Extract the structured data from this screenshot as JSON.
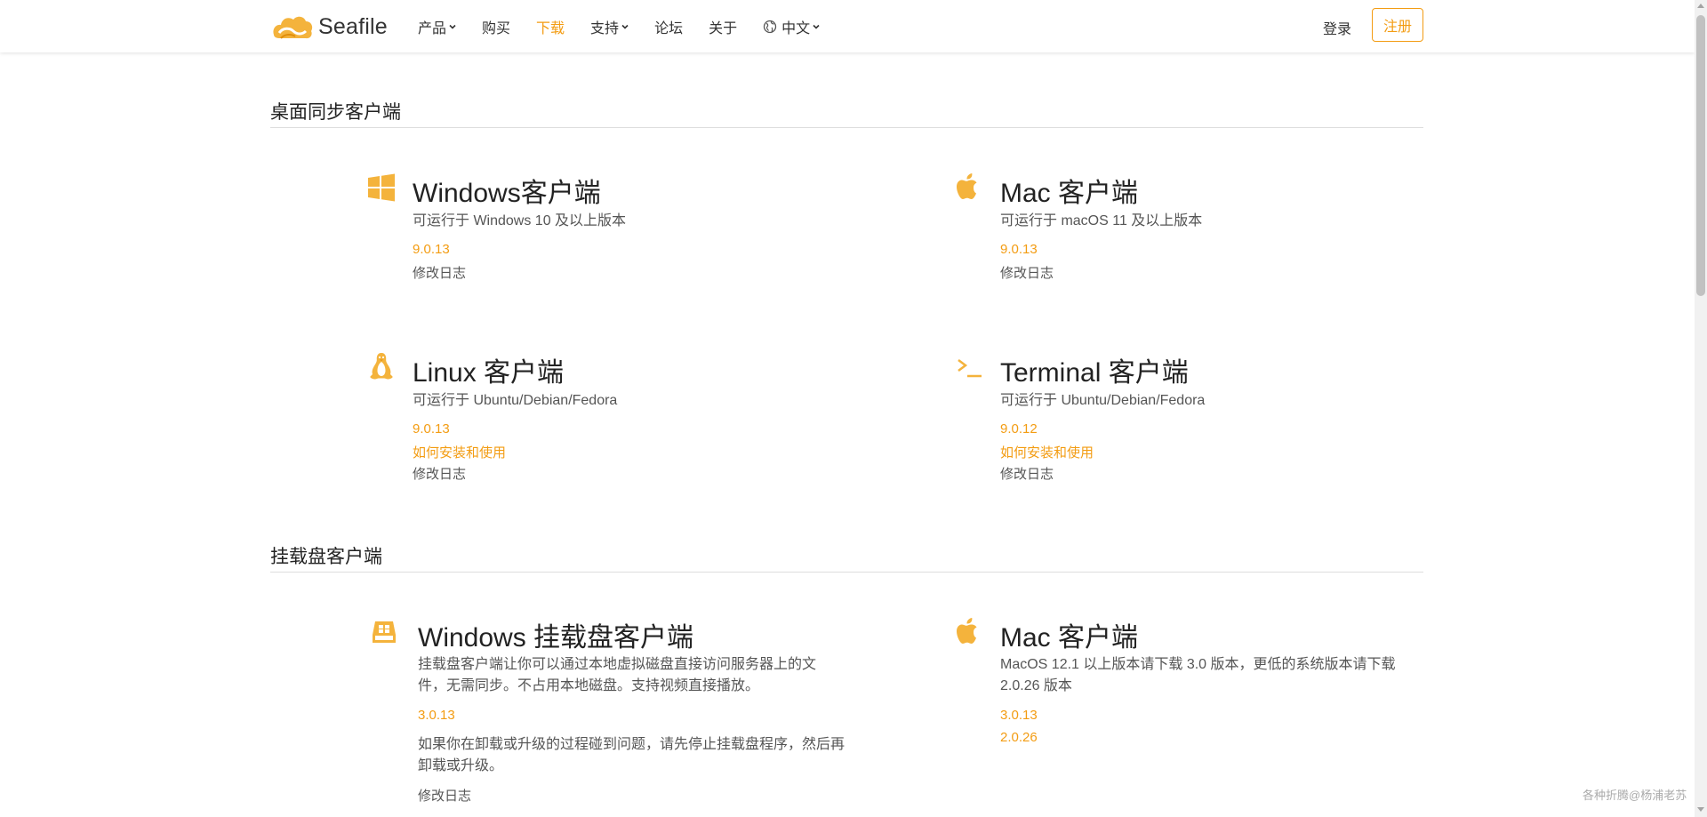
{
  "brand": {
    "name": "Seafile"
  },
  "nav": {
    "items": [
      {
        "label": "产品",
        "has_dropdown": true
      },
      {
        "label": "购买",
        "has_dropdown": false
      },
      {
        "label": "下载",
        "has_dropdown": false,
        "active": true
      },
      {
        "label": "支持",
        "has_dropdown": true
      },
      {
        "label": "论坛",
        "has_dropdown": false
      },
      {
        "label": "关于",
        "has_dropdown": false
      }
    ],
    "language": "中文",
    "login": "登录",
    "register": "注册"
  },
  "colors": {
    "accent": "#f39c12",
    "text": "#333333",
    "divider": "#dddddd"
  },
  "sections": [
    {
      "title": "桌面同步客户端",
      "clients": [
        {
          "icon": "windows-icon",
          "title": "Windows客户端",
          "desc": "可运行于 Windows 10 及以上版本",
          "links": [
            "9.0.13"
          ],
          "changelog": "修改日志"
        },
        {
          "icon": "apple-icon",
          "title": "Mac 客户端",
          "desc": "可运行于 macOS 11 及以上版本",
          "links": [
            "9.0.13"
          ],
          "changelog": "修改日志"
        },
        {
          "icon": "linux-icon",
          "title": "Linux 客户端",
          "desc": "可运行于 Ubuntu/Debian/Fedora",
          "links": [
            "9.0.13",
            "如何安装和使用"
          ],
          "changelog": "修改日志"
        },
        {
          "icon": "terminal-icon",
          "title": "Terminal 客户端",
          "desc": "可运行于 Ubuntu/Debian/Fedora",
          "links": [
            "9.0.12",
            "如何安装和使用"
          ],
          "changelog": "修改日志"
        }
      ]
    },
    {
      "title": "挂载盘客户端",
      "clients": [
        {
          "icon": "drive-icon",
          "title": "Windows 挂载盘客户端",
          "desc": "挂载盘客户端让你可以通过本地虚拟磁盘直接访问服务器上的文件，无需同步。不占用本地磁盘。支持视频直接播放。",
          "links": [
            "3.0.13"
          ],
          "note": "如果你在卸载或升级的过程碰到问题，请先停止挂载盘程序，然后再卸载或升级。",
          "changelog": "修改日志"
        },
        {
          "icon": "apple-icon",
          "title": "Mac 客户端",
          "desc": "MacOS 12.1 以上版本请下载 3.0 版本，更低的系统版本请下载 2.0.26 版本",
          "links": [
            "3.0.13",
            "2.0.26"
          ]
        }
      ]
    }
  ],
  "watermark": "各种折腾@杨浦老苏"
}
